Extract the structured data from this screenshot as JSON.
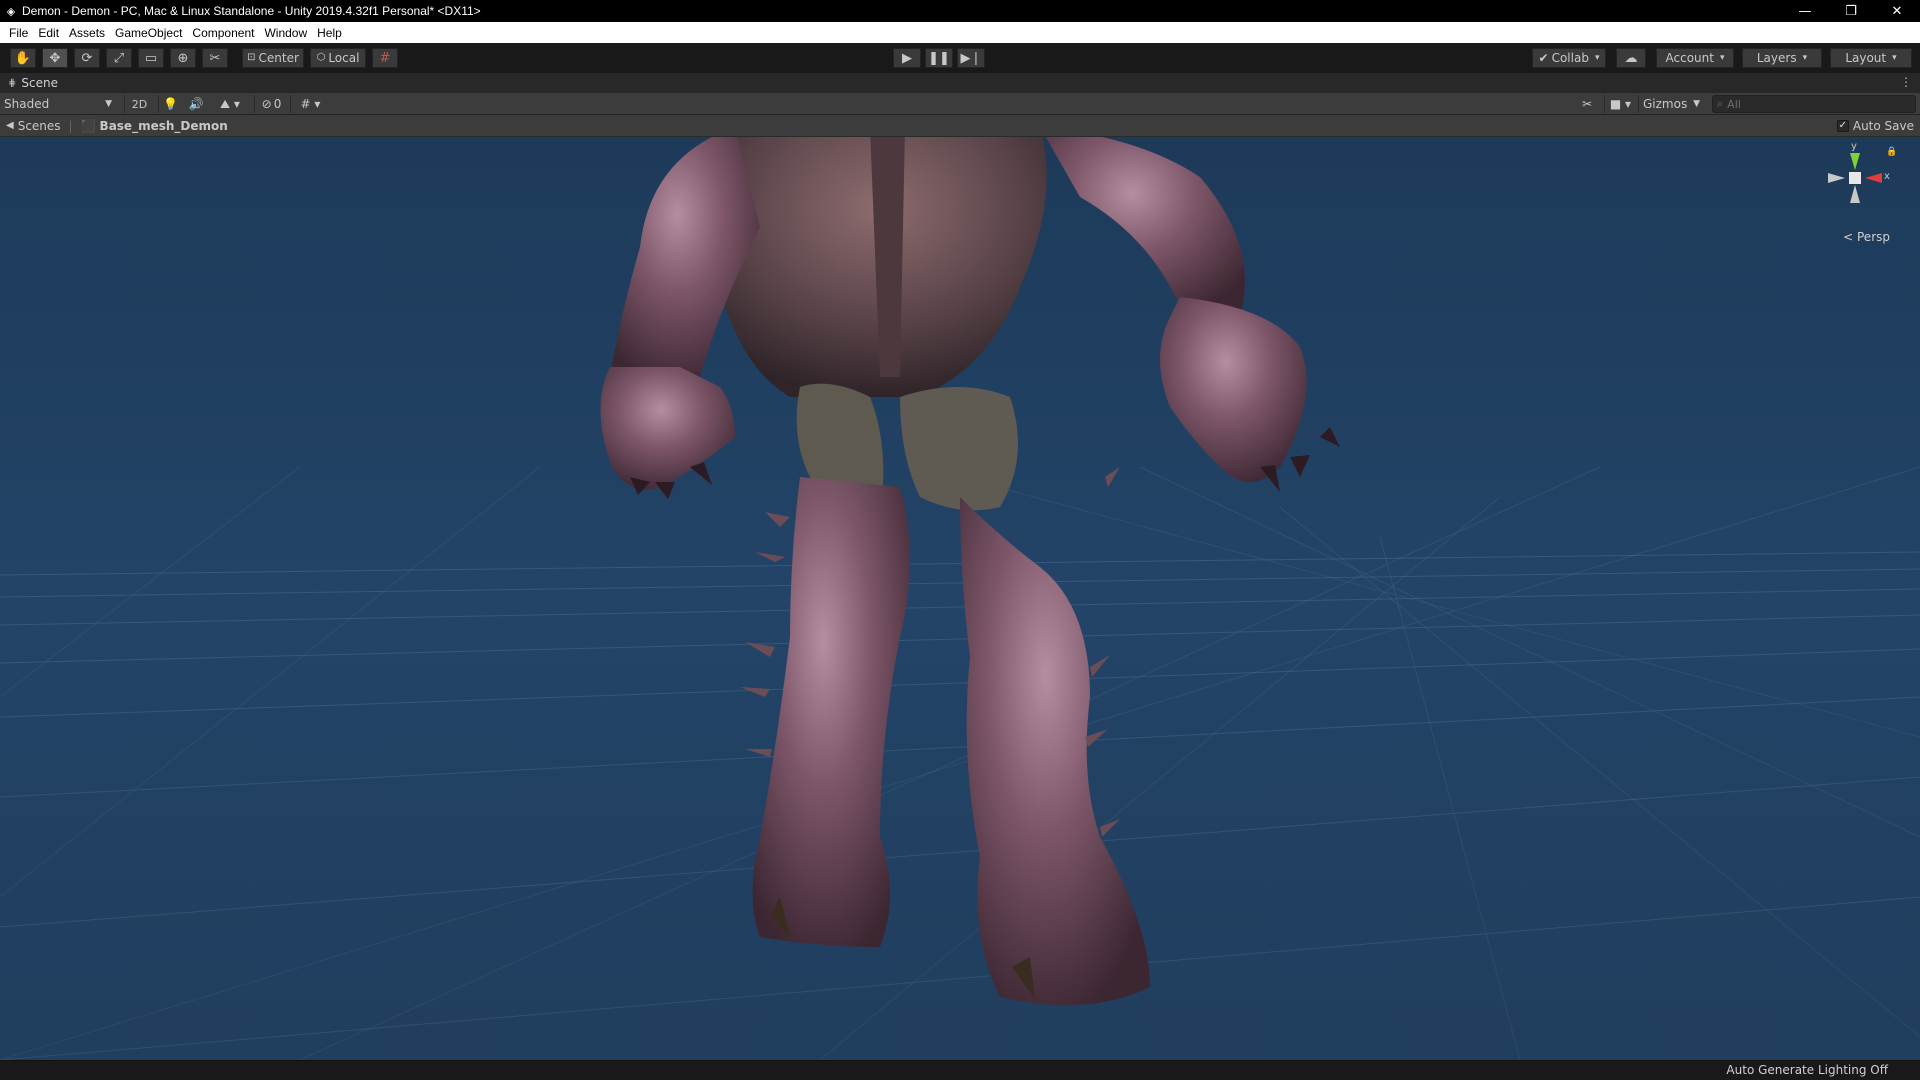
{
  "window": {
    "title": "Demon - Demon - PC, Mac & Linux Standalone - Unity 2019.4.32f1 Personal* <DX11>",
    "icon": "unity-logo-icon"
  },
  "menu": [
    "File",
    "Edit",
    "Assets",
    "GameObject",
    "Component",
    "Window",
    "Help"
  ],
  "toolbar": {
    "tools": [
      "hand-icon",
      "move-icon",
      "rotate-icon",
      "scale-icon",
      "rect-icon",
      "transform-icon",
      "custom-tool-icon"
    ],
    "active_tool": "move-icon",
    "pivot_label": "Center",
    "space_label": "Local",
    "collab_label": "Collab",
    "account_label": "Account",
    "layers_label": "Layers",
    "layout_label": "Layout"
  },
  "scene_tab": {
    "label": "Scene"
  },
  "scene_toolbar": {
    "draw_mode": "Shaded",
    "mode_2d": "2D",
    "hidden_count": "0",
    "gizmos_label": "Gizmos",
    "search_placeholder": "All"
  },
  "breadcrumb": {
    "root": "Scenes",
    "current": "Base_mesh_Demon"
  },
  "auto_save": {
    "label": "Auto Save",
    "checked": true
  },
  "gizmo": {
    "y": "y",
    "x": "x",
    "projection": "Persp"
  },
  "status": {
    "text": "Auto Generate Lighting Off"
  },
  "colors": {
    "background_sky": "#1e3a5a",
    "demon_skin": "#7a5566",
    "grid_line": "#3e6080",
    "axis_y": "#7fd13b",
    "axis_x": "#e23c3c"
  }
}
